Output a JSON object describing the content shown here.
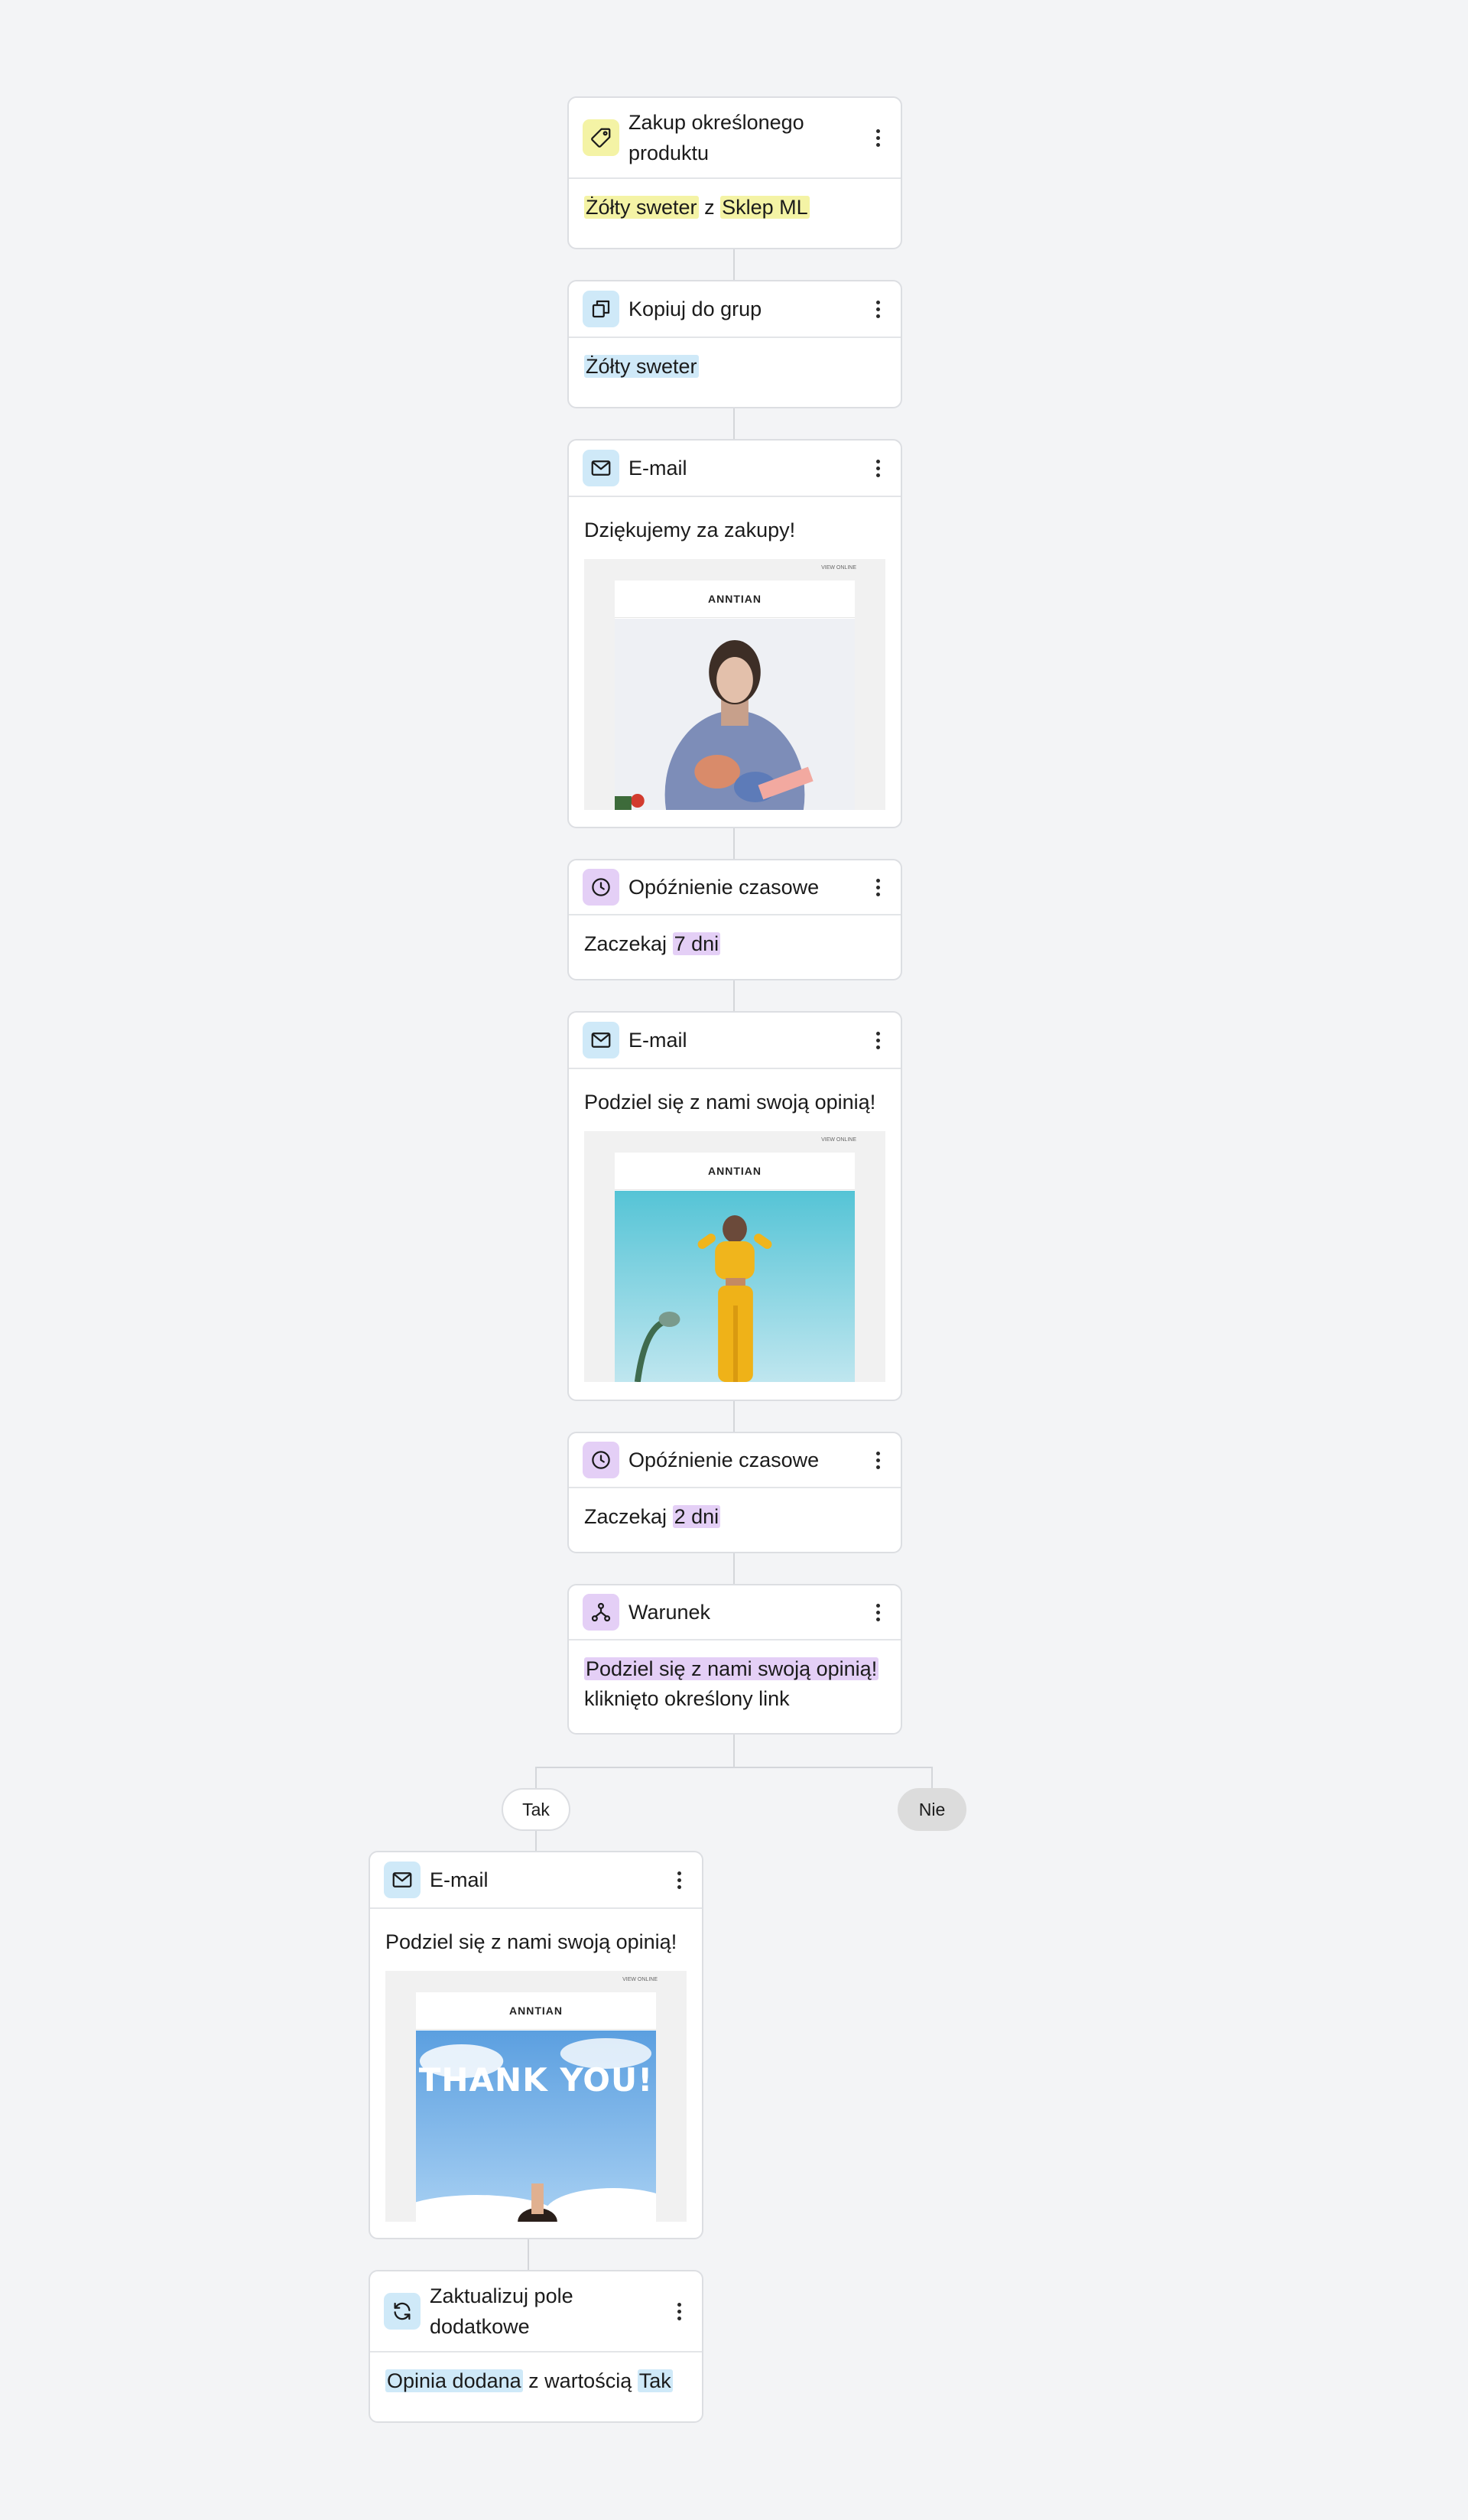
{
  "workflow": {
    "trigger": {
      "title": "Zakup określonego produktu",
      "product": "Żółty sweter",
      "connector": "z",
      "store": "Sklep ML",
      "icon": "tag-icon"
    },
    "copy_to_group": {
      "title": "Kopiuj do grup",
      "group": "Żółty sweter",
      "icon": "copy-icon"
    },
    "email_1": {
      "title": "E-mail",
      "subject": "Dziękujemy za zakupy!",
      "preview_brand": "ANNTIAN",
      "preview_top": "VIEW ONLINE",
      "icon": "mail-icon"
    },
    "delay_1": {
      "title": "Opóźnienie czasowe",
      "prefix": "Zaczekaj",
      "duration": "7 dni",
      "icon": "clock-icon"
    },
    "email_2": {
      "title": "E-mail",
      "subject": "Podziel się z nami swoją opinią!",
      "preview_brand": "ANNTIAN",
      "preview_top": "VIEW ONLINE",
      "icon": "mail-icon"
    },
    "delay_2": {
      "title": "Opóźnienie czasowe",
      "prefix": "Zaczekaj",
      "duration": "2 dni",
      "icon": "clock-icon"
    },
    "condition": {
      "title": "Warunek",
      "email_ref": "Podziel się z nami swoją opinią!",
      "rule": "kliknięto określony link",
      "icon": "branch-icon"
    },
    "branches": {
      "yes": "Tak",
      "no": "Nie"
    },
    "email_3": {
      "title": "E-mail",
      "subject": "Podziel się z nami swoją opinią!",
      "preview_brand": "ANNTIAN",
      "preview_top": "VIEW ONLINE",
      "preview_headline": "THANK YOU!",
      "icon": "mail-icon"
    },
    "update_field": {
      "title": "Zaktualizuj pole dodatkowe",
      "field": "Opinia dodana",
      "connector": "z wartością",
      "value": "Tak",
      "icon": "refresh-icon"
    }
  },
  "colors": {
    "background": "#f3f4f6",
    "yellow": "#f4f3a5",
    "blue": "#cfe9f8",
    "purple": "#e4cff6",
    "connector": "#d4d6da"
  }
}
